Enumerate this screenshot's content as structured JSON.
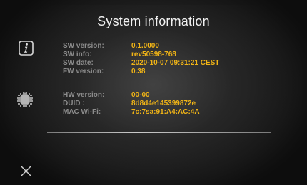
{
  "header": {
    "title": "System information"
  },
  "sidebar": {
    "info_icon": "info-icon",
    "device_icon": "chip-icon",
    "close_icon": "close-icon"
  },
  "software_section": {
    "rows": [
      {
        "label": "SW version:",
        "value": "0.1.0000"
      },
      {
        "label": "SW info:",
        "value": "rev50598-768"
      },
      {
        "label": "SW date:",
        "value": "2020-10-07 09:31:21 CEST"
      },
      {
        "label": "FW version:",
        "value": "0.38"
      }
    ]
  },
  "hardware_section": {
    "rows": [
      {
        "label": "HW version:",
        "value": "00-00"
      },
      {
        "label": "DUID :",
        "value": "8d8d4e145399872e"
      },
      {
        "label": "MAC Wi-Fi:",
        "value": "7c:7sa:91:A4:AC:4A"
      }
    ]
  },
  "colors": {
    "label": "#8c8c8c",
    "value": "#f2b516",
    "title": "#f2f2f2"
  }
}
